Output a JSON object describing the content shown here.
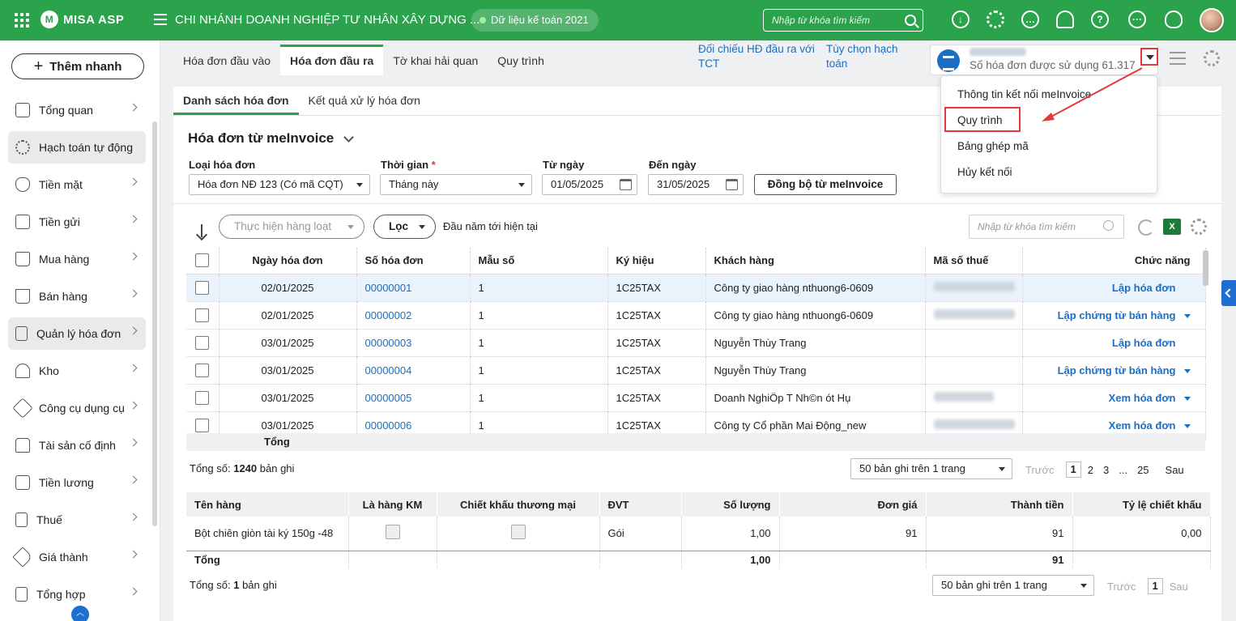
{
  "topbar": {
    "logo": "MISA ASP",
    "company": "CHI NHÁNH DOANH NGHIỆP TƯ NHÂN XÂY DỰNG ...",
    "data_pill": "Dữ liệu kế toán 2021",
    "search_placeholder": "Nhập từ khóa tìm kiếm",
    "icons": [
      "download-icon",
      "settings-icon",
      "chat-icon",
      "bell-icon",
      "help-icon",
      "more-icon",
      "lightbulb-icon"
    ],
    "accent": "#2ba24c"
  },
  "sidebar": {
    "add_button": "Thêm nhanh",
    "items": [
      {
        "label": "Tổng quan"
      },
      {
        "label": "Hạch toán tự động"
      },
      {
        "label": "Tiền mặt"
      },
      {
        "label": "Tiền gửi"
      },
      {
        "label": "Mua hàng"
      },
      {
        "label": "Bán hàng"
      },
      {
        "label": "Quản lý hóa đơn"
      },
      {
        "label": "Kho"
      },
      {
        "label": "Công cụ dụng cụ"
      },
      {
        "label": "Tài sản cố định"
      },
      {
        "label": "Tiền lương"
      },
      {
        "label": "Thuế"
      },
      {
        "label": "Giá thành"
      },
      {
        "label": "Tổng hợp"
      }
    ]
  },
  "tabs": [
    "Hóa đơn đầu vào",
    "Hóa đơn đầu ra",
    "Tờ khai hải quan",
    "Quy trình"
  ],
  "top_links": {
    "reconcile": "Đối chiếu HĐ đầu ra với TCT",
    "options": "Tùy chọn hạch toán"
  },
  "invoice_box": {
    "usage": "Số hóa đơn được sử dụng 61.317"
  },
  "dropdown": {
    "items": [
      "Thông tin kết nối meInvoice",
      "Quy trình",
      "Bảng ghép mã",
      "Hủy kết nối"
    ]
  },
  "subtabs": [
    "Danh sách hóa đơn",
    "Kết quả xử lý hóa đơn"
  ],
  "section_title": "Hóa đơn từ meInvoice",
  "filters": {
    "type_label": "Loại hóa đơn",
    "type_value": "Hóa đơn NĐ 123 (Có mã CQT)",
    "time_label": "Thời gian",
    "time_value": "Tháng này",
    "from_label": "Từ ngày",
    "from_value": "01/05/2025",
    "to_label": "Đến ngày",
    "to_value": "31/05/2025",
    "sync_button": "Đồng bộ từ meInvoice"
  },
  "toolbar": {
    "batch": "Thực hiện hàng loạt",
    "filter": "Lọc",
    "period": "Đầu năm tới hiện tại",
    "search_placeholder": "Nhập từ khóa tìm kiếm"
  },
  "grid": {
    "columns": [
      "Ngày hóa đơn",
      "Số hóa đơn",
      "Mẫu số",
      "Ký hiệu",
      "Khách hàng",
      "Mã số thuế",
      "Chức năng"
    ],
    "rows": [
      {
        "date": "02/01/2025",
        "number": "00000001",
        "form": "1",
        "symbol": "1C25TAX",
        "customer": "Công ty giao hàng nthuong6-0609",
        "action": "Lập hóa đơn",
        "has_tax": true,
        "has_dd": false
      },
      {
        "date": "02/01/2025",
        "number": "00000002",
        "form": "1",
        "symbol": "1C25TAX",
        "customer": "Công ty giao hàng nthuong6-0609",
        "action": "Lập chứng từ bán hàng",
        "has_tax": true,
        "has_dd": true
      },
      {
        "date": "03/01/2025",
        "number": "00000003",
        "form": "1",
        "symbol": "1C25TAX",
        "customer": "Nguyễn Thùy Trang",
        "action": "Lập hóa đơn",
        "has_tax": false,
        "has_dd": false
      },
      {
        "date": "03/01/2025",
        "number": "00000004",
        "form": "1",
        "symbol": "1C25TAX",
        "customer": "Nguyễn Thùy Trang",
        "action": "Lập chứng từ bán hàng",
        "has_tax": false,
        "has_dd": true
      },
      {
        "date": "03/01/2025",
        "number": "00000005",
        "form": "1",
        "symbol": "1C25TAX",
        "customer": "Doanh NghiÖp T Nh©n ót Hụ",
        "action": "Xem hóa đơn",
        "has_tax": true,
        "has_dd": true
      },
      {
        "date": "03/01/2025",
        "number": "00000006",
        "form": "1",
        "symbol": "1C25TAX",
        "customer": "Công ty Cổ phần Mai Động_new",
        "action": "Xem hóa đơn",
        "has_tax": true,
        "has_dd": true
      }
    ],
    "total_label": "Tổng",
    "count_prefix": "Tổng số:",
    "count_value": "1240",
    "count_suffix": "bản ghi",
    "page_size": "50 bản ghi trên 1 trang",
    "pager": {
      "prev": "Trước",
      "pages": [
        "1",
        "2",
        "3",
        "...",
        "25"
      ],
      "next": "Sau"
    }
  },
  "detail": {
    "columns": [
      "Tên hàng",
      "Là hàng KM",
      "Chiết khấu thương mại",
      "ĐVT",
      "Số lượng",
      "Đơn giá",
      "Thành tiền",
      "Tỷ lệ chiết khấu"
    ],
    "row": {
      "name": "Bột chiên giòn tài ký 150g -48",
      "unit": "Gói",
      "qty": "1,00",
      "price": "91",
      "amount": "91",
      "discount": "0,00"
    },
    "total_label": "Tổng",
    "total_qty": "1,00",
    "total_amount": "91",
    "count_prefix": "Tổng số:",
    "count_value": "1",
    "count_suffix": "bản ghi",
    "page_size": "50 bản ghi trên 1 trang",
    "pager": {
      "prev": "Trước",
      "page": "1",
      "next": "Sau"
    }
  }
}
